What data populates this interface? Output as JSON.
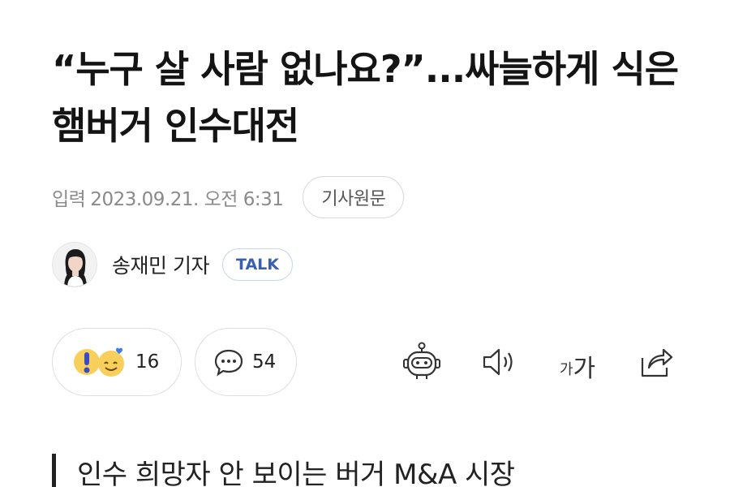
{
  "article": {
    "headline": "“누구 살 사람 없나요?”...싸늘하게 식은 햄버거 인수대전",
    "date_label": "입력",
    "date_value": "2023.09.21. 오전 6:31",
    "source_button_label": "기사원문",
    "reporter": {
      "name": "송재민 기자",
      "badge_label": "TALK"
    },
    "subheading": "인수 희망자 안 보이는 버거 M&A 시장"
  },
  "actions": {
    "reaction_count": "16",
    "comment_count": "54",
    "font_size_small": "가",
    "font_size_large": "가"
  },
  "icons": {
    "reaction": [
      "surprised-emoji-icon",
      "smiling-heart-emoji-icon"
    ],
    "comment": "speech-bubble-icon",
    "summary": "robot-icon",
    "audio": "speaker-icon",
    "share": "share-icon"
  }
}
